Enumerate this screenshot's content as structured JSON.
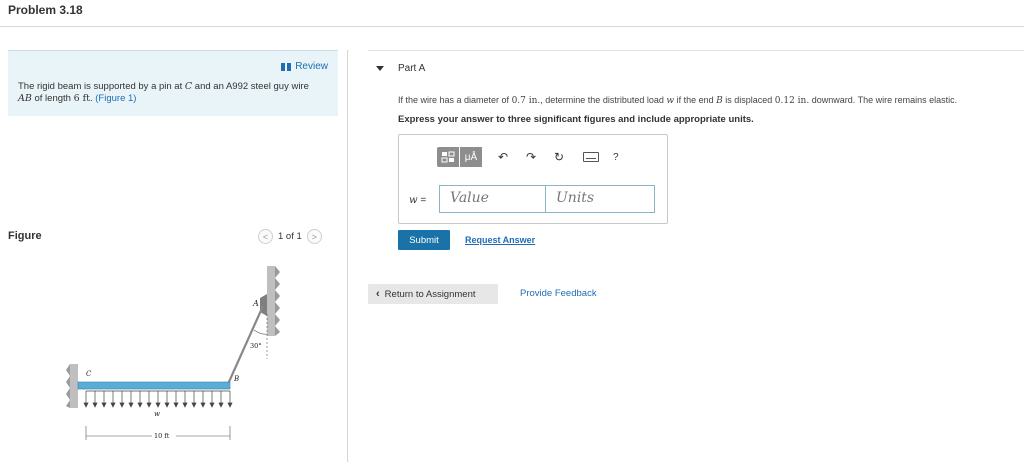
{
  "header": {
    "title": "Problem 3.18"
  },
  "problem": {
    "review_label": "Review",
    "text_1": "The rigid beam is supported by a pin at ",
    "point_c": "C",
    "text_2": " and an A992 steel guy wire",
    "segment_ab": "AB",
    "text_3": " of length ",
    "length": "6 ft",
    "text_4": ". ",
    "figure_link": "(Figure 1)"
  },
  "figure_panel": {
    "label": "Figure",
    "pager_text": "1 of 1",
    "prev_icon": "chevron-left-icon",
    "next_icon": "chevron-right-icon",
    "labels": {
      "a": "A",
      "b": "B",
      "c": "C",
      "w": "w",
      "angle": "30°",
      "dimension": "10 ft"
    }
  },
  "part_a": {
    "title": "Part A",
    "question_1": "If the wire has a diameter of ",
    "diameter": "0.7 in.",
    "question_2": ", determine the distributed load ",
    "w_var": "w",
    "question_3": " if the end ",
    "b_var": "B",
    "question_4": " is displaced ",
    "displacement": "0.12 in.",
    "question_5": " downward. The wire remains elastic.",
    "instruction": "Express your answer to three significant figures and include appropriate units.",
    "answer_label": "w",
    "answer_equals": " =",
    "value_placeholder": "Value",
    "units_placeholder": "Units",
    "toolbar": {
      "templates_icon": "templates-icon",
      "units_label": "μÅ",
      "undo_icon": "undo-icon",
      "redo_icon": "redo-icon",
      "reset_icon": "reset-icon",
      "keyboard_icon": "keyboard-icon",
      "help_label": "?"
    },
    "submit_label": "Submit",
    "request_answer_label": "Request Answer"
  },
  "footer": {
    "return_label": "Return to Assignment",
    "feedback_label": "Provide Feedback"
  },
  "colors": {
    "accent": "#1a73a8",
    "link": "#1f6db5",
    "beam": "#5aaed6",
    "panel": "#e8f4f8"
  }
}
